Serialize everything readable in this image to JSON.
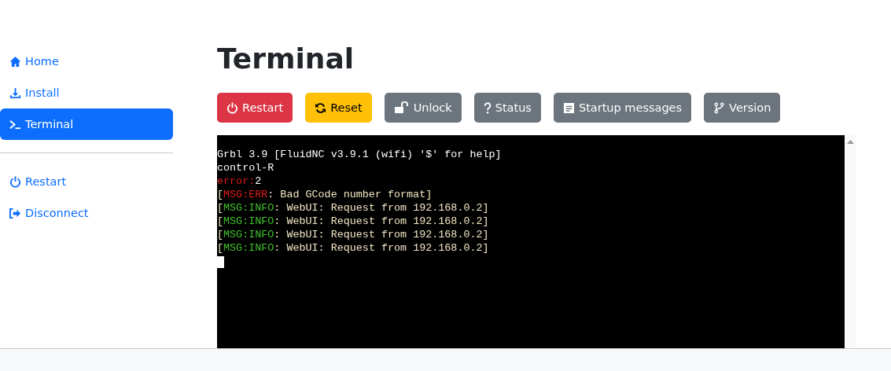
{
  "sidebar": {
    "items": [
      {
        "label": "Home",
        "selected": false
      },
      {
        "label": "Install",
        "selected": false
      },
      {
        "label": "Terminal",
        "selected": true
      }
    ],
    "actions": [
      {
        "label": "Restart",
        "selected": false
      },
      {
        "label": "Disconnect",
        "selected": false
      }
    ]
  },
  "page": {
    "title": "Terminal"
  },
  "buttons": [
    {
      "label": "Restart",
      "kind": "danger"
    },
    {
      "label": "Reset",
      "kind": "warning"
    },
    {
      "label": "Unlock",
      "kind": "secondary"
    },
    {
      "label": "Status",
      "kind": "secondary"
    },
    {
      "label": "Startup messages",
      "kind": "secondary"
    },
    {
      "label": "Version",
      "kind": "secondary"
    }
  ],
  "terminal": {
    "lines": [
      [
        {
          "text": "Grbl 3.9 [FluidNC v3.9.1 (wifi) '$' for help]",
          "color": "#ffffff"
        }
      ],
      [
        {
          "text": "control-R",
          "color": "#ffffff"
        }
      ],
      [
        {
          "text": "error:",
          "color": "#e01b1b"
        },
        {
          "text": "2",
          "color": "#ffffff"
        }
      ],
      [
        {
          "text": "[",
          "color": "#f2e6c4"
        },
        {
          "text": "MSG:ERR",
          "color": "#e01b1b"
        },
        {
          "text": ": Bad GCode number format]",
          "color": "#f2e6c4"
        }
      ],
      [
        {
          "text": "[",
          "color": "#f2e6c4"
        },
        {
          "text": "MSG:INFO",
          "color": "#3fc22a"
        },
        {
          "text": ": WebUI: Request from 192.168.0.2]",
          "color": "#f2e6c4"
        }
      ],
      [
        {
          "text": "[",
          "color": "#f2e6c4"
        },
        {
          "text": "MSG:INFO",
          "color": "#3fc22a"
        },
        {
          "text": ": WebUI: Request from 192.168.0.2]",
          "color": "#f2e6c4"
        }
      ],
      [
        {
          "text": "[",
          "color": "#f2e6c4"
        },
        {
          "text": "MSG:INFO",
          "color": "#3fc22a"
        },
        {
          "text": ": WebUI: Request from 192.168.0.2]",
          "color": "#f2e6c4"
        }
      ],
      [
        {
          "text": "[",
          "color": "#f2e6c4"
        },
        {
          "text": "MSG:INFO",
          "color": "#3fc22a"
        },
        {
          "text": ": WebUI: Request from 192.168.0.2]",
          "color": "#f2e6c4"
        }
      ]
    ],
    "cursor": true
  }
}
